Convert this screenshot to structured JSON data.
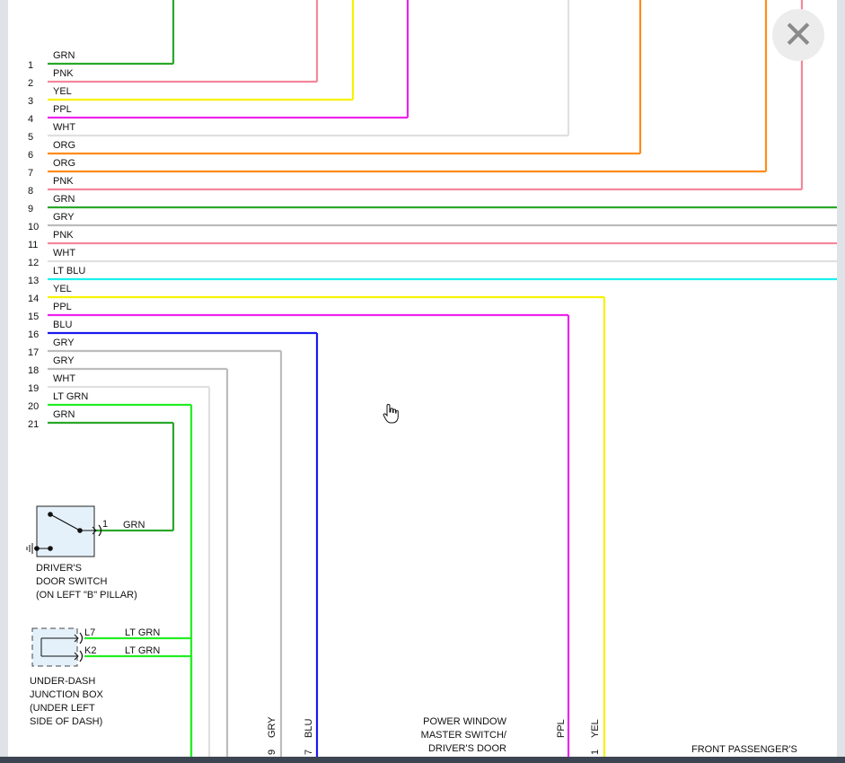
{
  "close_icon_glyph": "✕",
  "pins": [
    "1",
    "2",
    "3",
    "4",
    "5",
    "6",
    "7",
    "8",
    "9",
    "10",
    "11",
    "12",
    "13",
    "14",
    "15",
    "16",
    "17",
    "18",
    "19",
    "20",
    "21"
  ],
  "wires": [
    {
      "color_name": "GRN",
      "stroke": "#2aa82a"
    },
    {
      "color_name": "PNK",
      "stroke": "#f4879a"
    },
    {
      "color_name": "YEL",
      "stroke": "#f6f200"
    },
    {
      "color_name": "PPL",
      "stroke": "#ee22ee"
    },
    {
      "color_name": "WHT",
      "stroke": "#e0e0e0"
    },
    {
      "color_name": "ORG",
      "stroke": "#ff8c1a"
    },
    {
      "color_name": "ORG",
      "stroke": "#ff8c1a"
    },
    {
      "color_name": "PNK",
      "stroke": "#f4879a"
    },
    {
      "color_name": "GRN",
      "stroke": "#2aa82a"
    },
    {
      "color_name": "GRY",
      "stroke": "#bcbcbc"
    },
    {
      "color_name": "PNK",
      "stroke": "#f4879a"
    },
    {
      "color_name": "WHT",
      "stroke": "#e0e0e0"
    },
    {
      "color_name": "LT BLU",
      "stroke": "#19f0f0"
    },
    {
      "color_name": "YEL",
      "stroke": "#f6f200"
    },
    {
      "color_name": "PPL",
      "stroke": "#ee22ee"
    },
    {
      "color_name": "BLU",
      "stroke": "#1a1aee"
    },
    {
      "color_name": "GRY",
      "stroke": "#bcbcbc"
    },
    {
      "color_name": "GRY",
      "stroke": "#bcbcbc"
    },
    {
      "color_name": "WHT",
      "stroke": "#e0e0e0"
    },
    {
      "color_name": "LT GRN",
      "stroke": "#22ee22"
    },
    {
      "color_name": "GRN",
      "stroke": "#2aa82a"
    }
  ],
  "door_switch": {
    "pin": "1",
    "wire": "GRN",
    "label": [
      "DRIVER'S",
      "DOOR SWITCH",
      "(ON LEFT \"B\" PILLAR)"
    ]
  },
  "junction_box": {
    "pins": [
      "L7",
      "K2"
    ],
    "wires": [
      "LT GRN",
      "LT GRN"
    ],
    "label": [
      "UNDER-DASH",
      "JUNCTION BOX",
      "(UNDER LEFT",
      "SIDE OF DASH)"
    ]
  },
  "bottom_wire_labels": [
    {
      "pin": "9",
      "color": "GRY"
    },
    {
      "pin": "7",
      "color": "BLU"
    },
    {
      "pin": "",
      "color": "PPL"
    },
    {
      "pin": "1",
      "color": "YEL"
    }
  ],
  "master_switch_label": [
    "POWER WINDOW",
    "MASTER SWITCH/",
    "DRIVER'S DOOR"
  ],
  "passenger_label": "FRONT PASSENGER'S"
}
